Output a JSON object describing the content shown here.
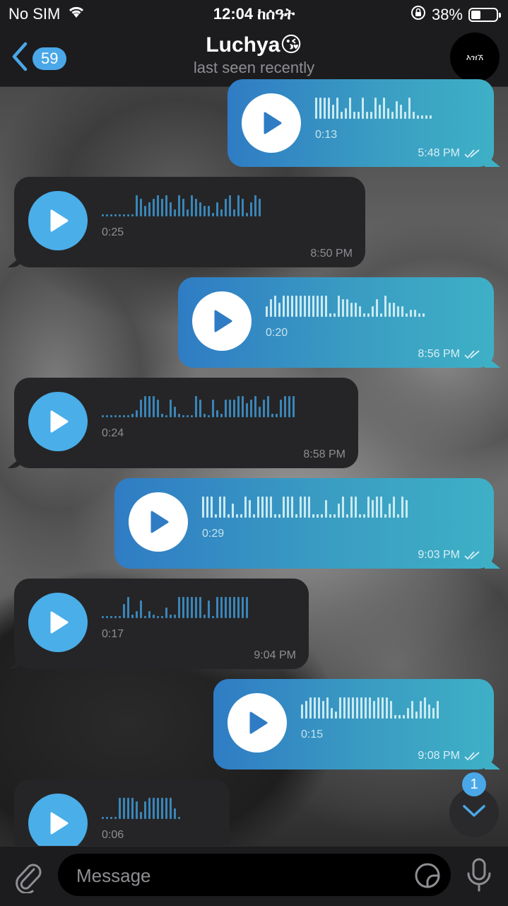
{
  "status": {
    "carrier": "No SIM",
    "time": "12:04 ከሰዓት",
    "battery": "38%",
    "battery_level": 0.38
  },
  "header": {
    "back_count": "59",
    "title": "Luchya😘",
    "subtitle": "last seen recently",
    "avatar_text": "እዝኧ"
  },
  "messages": [
    {
      "dir": "out",
      "duration": "0:13",
      "time": "5:48 PM",
      "read": true,
      "wave": [
        30,
        30,
        30,
        30,
        20,
        30,
        10,
        15,
        30,
        10,
        10,
        30,
        10,
        10,
        30,
        20,
        30,
        15,
        10,
        25,
        20,
        10,
        30,
        10,
        5,
        5,
        5,
        5
      ]
    },
    {
      "dir": "in",
      "duration": "0:25",
      "time": "8:50 PM",
      "read": false,
      "wave": [
        3,
        3,
        3,
        3,
        3,
        3,
        3,
        3,
        30,
        25,
        15,
        20,
        25,
        30,
        25,
        30,
        20,
        10,
        30,
        25,
        10,
        30,
        25,
        20,
        15,
        15,
        5,
        20,
        10,
        25,
        30,
        10,
        30,
        25,
        5,
        20,
        30,
        25
      ]
    },
    {
      "dir": "out",
      "duration": "0:20",
      "time": "8:56 PM",
      "read": true,
      "wave": [
        15,
        25,
        30,
        20,
        30,
        30,
        30,
        30,
        30,
        30,
        30,
        30,
        30,
        30,
        30,
        5,
        5,
        30,
        25,
        25,
        20,
        20,
        15,
        5,
        5,
        15,
        25,
        5,
        30,
        20,
        20,
        15,
        15,
        5,
        10,
        10,
        5,
        5
      ]
    },
    {
      "dir": "in",
      "duration": "0:24",
      "time": "8:58 PM",
      "read": false,
      "wave": [
        3,
        3,
        3,
        3,
        3,
        3,
        3,
        5,
        10,
        25,
        30,
        30,
        30,
        25,
        5,
        3,
        25,
        15,
        5,
        3,
        3,
        3,
        30,
        25,
        5,
        3,
        25,
        10,
        5,
        25,
        25,
        25,
        30,
        30,
        20,
        25,
        30,
        15,
        25,
        30,
        5,
        5,
        25,
        30,
        30,
        30
      ]
    },
    {
      "dir": "out",
      "duration": "0:29",
      "time": "9:03 PM",
      "read": true,
      "wave": [
        30,
        30,
        30,
        5,
        30,
        30,
        5,
        20,
        5,
        5,
        30,
        25,
        5,
        30,
        30,
        30,
        30,
        5,
        5,
        30,
        30,
        30,
        5,
        30,
        30,
        30,
        5,
        5,
        5,
        25,
        5,
        5,
        20,
        30,
        5,
        30,
        30,
        5,
        5,
        30,
        25,
        30,
        30,
        5,
        20,
        30,
        5,
        30,
        25
      ]
    },
    {
      "dir": "in",
      "duration": "0:17",
      "time": "9:04 PM",
      "read": false,
      "wave": [
        3,
        3,
        3,
        3,
        3,
        20,
        30,
        5,
        10,
        25,
        3,
        10,
        5,
        3,
        3,
        15,
        5,
        5,
        30,
        30,
        30,
        30,
        30,
        30,
        5,
        25,
        3,
        30,
        30,
        30,
        30,
        30,
        30,
        30,
        30
      ]
    },
    {
      "dir": "out",
      "duration": "0:15",
      "time": "9:08 PM",
      "read": true,
      "wave": [
        20,
        25,
        30,
        30,
        30,
        25,
        30,
        15,
        10,
        30,
        30,
        30,
        30,
        30,
        30,
        30,
        30,
        25,
        30,
        30,
        30,
        25,
        5,
        5,
        5,
        15,
        25,
        10,
        25,
        30,
        20,
        15,
        25
      ]
    },
    {
      "dir": "in",
      "duration": "0:06",
      "time": "",
      "read": false,
      "wave": [
        3,
        3,
        3,
        3,
        30,
        30,
        30,
        30,
        25,
        10,
        25,
        30,
        30,
        30,
        30,
        30,
        30,
        15,
        3
      ]
    }
  ],
  "scroll": {
    "unread": "1"
  },
  "input": {
    "placeholder": "Message"
  },
  "colors": {
    "accent": "#4aa8e8",
    "out_bubble_start": "#2f7cc4",
    "out_bubble_end": "#3eb0c6",
    "in_bubble": "#252527"
  }
}
